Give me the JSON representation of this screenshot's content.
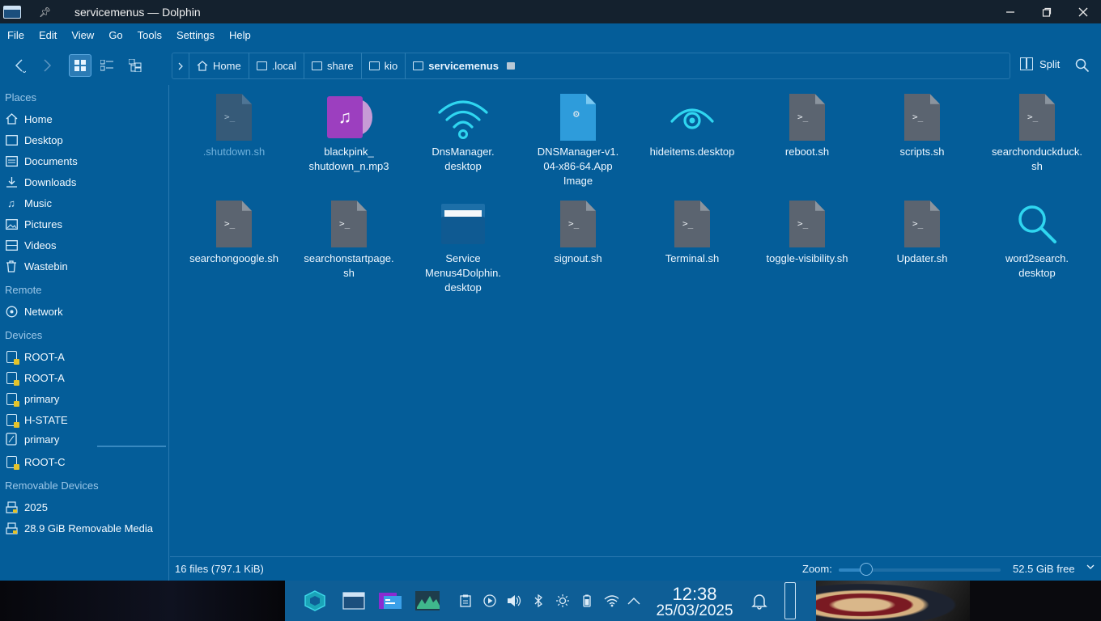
{
  "window": {
    "title": "servicemenus — Dolphin"
  },
  "menubar": [
    "File",
    "Edit",
    "View",
    "Go",
    "Tools",
    "Settings",
    "Help"
  ],
  "breadcrumb": {
    "items": [
      "Home",
      ".local",
      "share",
      "kio"
    ],
    "current": "servicemenus"
  },
  "toolbar": {
    "split_label": "Split"
  },
  "sidebar": {
    "places_label": "Places",
    "places": [
      "Home",
      "Desktop",
      "Documents",
      "Downloads",
      "Music",
      "Pictures",
      "Videos",
      "Wastebin"
    ],
    "remote_label": "Remote",
    "remote": [
      "Network"
    ],
    "devices_label": "Devices",
    "devices": [
      "ROOT-A",
      "ROOT-A",
      "primary",
      "H-STATE",
      "primary",
      "ROOT-C"
    ],
    "removable_label": "Removable Devices",
    "removable": [
      "2025",
      "28.9 GiB Removable Media"
    ]
  },
  "files": [
    {
      "name": ".shutdown.sh",
      "icon": "script-icon",
      "hidden": true
    },
    {
      "name": "blackpink_\nshutdown_n.mp3",
      "icon": "audio-icon"
    },
    {
      "name": "DnsManager.\ndesktop",
      "icon": "wifi-icon"
    },
    {
      "name": "DNSManager-v1.\n04-x86-64.App\nImage",
      "icon": "appimage-icon"
    },
    {
      "name": "hideitems.desktop",
      "icon": "eye-icon"
    },
    {
      "name": "reboot.sh",
      "icon": "script-icon"
    },
    {
      "name": "scripts.sh",
      "icon": "script-icon"
    },
    {
      "name": "searchonduckduck.\nsh",
      "icon": "script-icon"
    },
    {
      "name": "searchongoogle.sh",
      "icon": "script-icon"
    },
    {
      "name": "searchonstartpage.\nsh",
      "icon": "script-icon"
    },
    {
      "name": "Service\nMenus4Dolphin.\ndesktop",
      "icon": "folder-icon"
    },
    {
      "name": "signout.sh",
      "icon": "script-icon"
    },
    {
      "name": "Terminal.sh",
      "icon": "script-icon"
    },
    {
      "name": "toggle-visibility.sh",
      "icon": "script-icon"
    },
    {
      "name": "Updater.sh",
      "icon": "script-icon"
    },
    {
      "name": "word2search.\ndesktop",
      "icon": "search-icon"
    }
  ],
  "status": {
    "count": "16 files (797.1 KiB)",
    "zoom_label": "Zoom:",
    "zoom_level": 0.17,
    "free": "52.5 GiB free"
  },
  "taskbar": {
    "time": "12:38",
    "date": "25/03/2025"
  },
  "colors": {
    "window_bg": "#045d99",
    "titlebar_bg": "#14212e",
    "accent": "#2fd6f0",
    "taskbar_bg": "#0e5e96"
  }
}
